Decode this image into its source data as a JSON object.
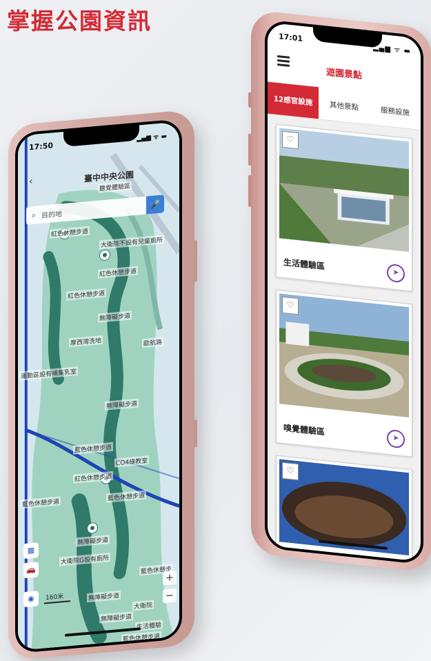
{
  "headline": "掌握公園資訊",
  "map_phone": {
    "time": "17:50",
    "status_icons": "▂▄▆ ᯤ ▬",
    "title": "臺中中央公園",
    "subtitle": "聽覺體驗區",
    "search_placeholder": "目的地",
    "labels": [
      "紅色休憩步道",
      "大衛院不設有兒童廁所",
      "紅色休憩步道",
      "紅色休憩步道",
      "無障礙步道",
      "摩西灣洗地",
      "歐航路",
      "運動區設有哺集乳室",
      "無障礙步道",
      "藍色休憩步道",
      "CO4綠教室",
      "紅色休憩步道",
      "藍色休憩步道",
      "藍色休憩步道",
      "無障礙步道",
      "大衛院G設有廁所",
      "藍色休憩步",
      "無障礙步道",
      "大衛院",
      "無障礙步道",
      "生活體驗",
      "藍色休憩步道"
    ],
    "scale": "160米",
    "zoom_in": "+",
    "zoom_out": "−",
    "colors": {
      "park_green": "#8ec9b4",
      "path_green": "#2f7a68",
      "road_blue": "#1f44b6"
    }
  },
  "app_phone": {
    "time": "17:01",
    "status_icons": "▂▄▆ ᯤ ▬",
    "title": "遊園景點",
    "tabs": [
      {
        "label": "12感官設施",
        "active": true
      },
      {
        "label": "其他景點",
        "active": false
      },
      {
        "label": "服務設施",
        "active": false
      }
    ],
    "cards": [
      {
        "label": "生活體驗區"
      },
      {
        "label": "嗅覺體驗區"
      },
      {
        "label": ""
      }
    ],
    "colors": {
      "accent": "#d42a35",
      "nav_icon": "#7b3fb0"
    }
  }
}
